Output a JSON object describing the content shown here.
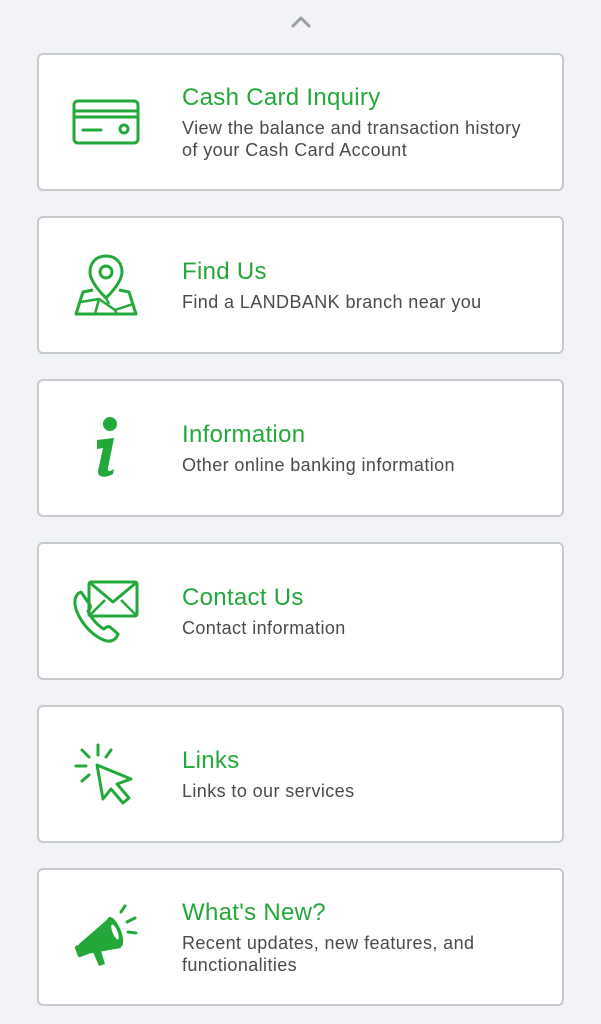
{
  "menu": {
    "items": [
      {
        "icon": "credit-card-icon",
        "title": "Cash Card Inquiry",
        "description": "View the balance and transaction history of your Cash Card Account"
      },
      {
        "icon": "map-pin-icon",
        "title": "Find Us",
        "description": "Find a LANDBANK branch near you"
      },
      {
        "icon": "info-icon",
        "title": "Information",
        "description": "Other online banking information"
      },
      {
        "icon": "phone-envelope-icon",
        "title": "Contact Us",
        "description": "Contact information"
      },
      {
        "icon": "cursor-click-icon",
        "title": "Links",
        "description": "Links to our services"
      },
      {
        "icon": "megaphone-icon",
        "title": "What's New?",
        "description": "Recent updates, new features, and functionalities"
      }
    ]
  },
  "colors": {
    "accent": "#23a83a",
    "background": "#f1f3f6",
    "card": "#ffffff",
    "border": "#c6c9cd",
    "text_secondary": "#4a4a4a"
  }
}
